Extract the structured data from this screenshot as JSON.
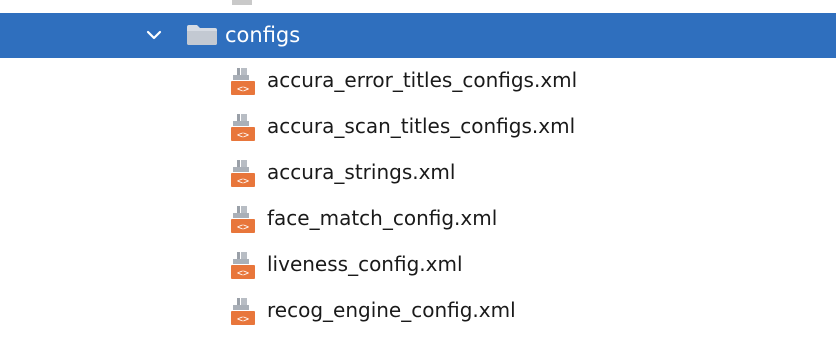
{
  "tree": {
    "partial_item": {
      "label": "",
      "icon": "file-icon"
    },
    "folder": {
      "label": "configs",
      "expanded": true,
      "selected": true,
      "icon": "folder-icon",
      "selected_color": "#2f6fbe"
    },
    "files": [
      {
        "label": "accura_error_titles_configs.xml",
        "icon": "xml-file-icon"
      },
      {
        "label": "accura_scan_titles_configs.xml",
        "icon": "xml-file-icon"
      },
      {
        "label": "accura_strings.xml",
        "icon": "xml-file-icon"
      },
      {
        "label": "face_match_config.xml",
        "icon": "xml-file-icon"
      },
      {
        "label": "liveness_config.xml",
        "icon": "xml-file-icon"
      },
      {
        "label": "recog_engine_config.xml",
        "icon": "xml-file-icon"
      }
    ],
    "xml_icon_color": "#e8763b"
  }
}
